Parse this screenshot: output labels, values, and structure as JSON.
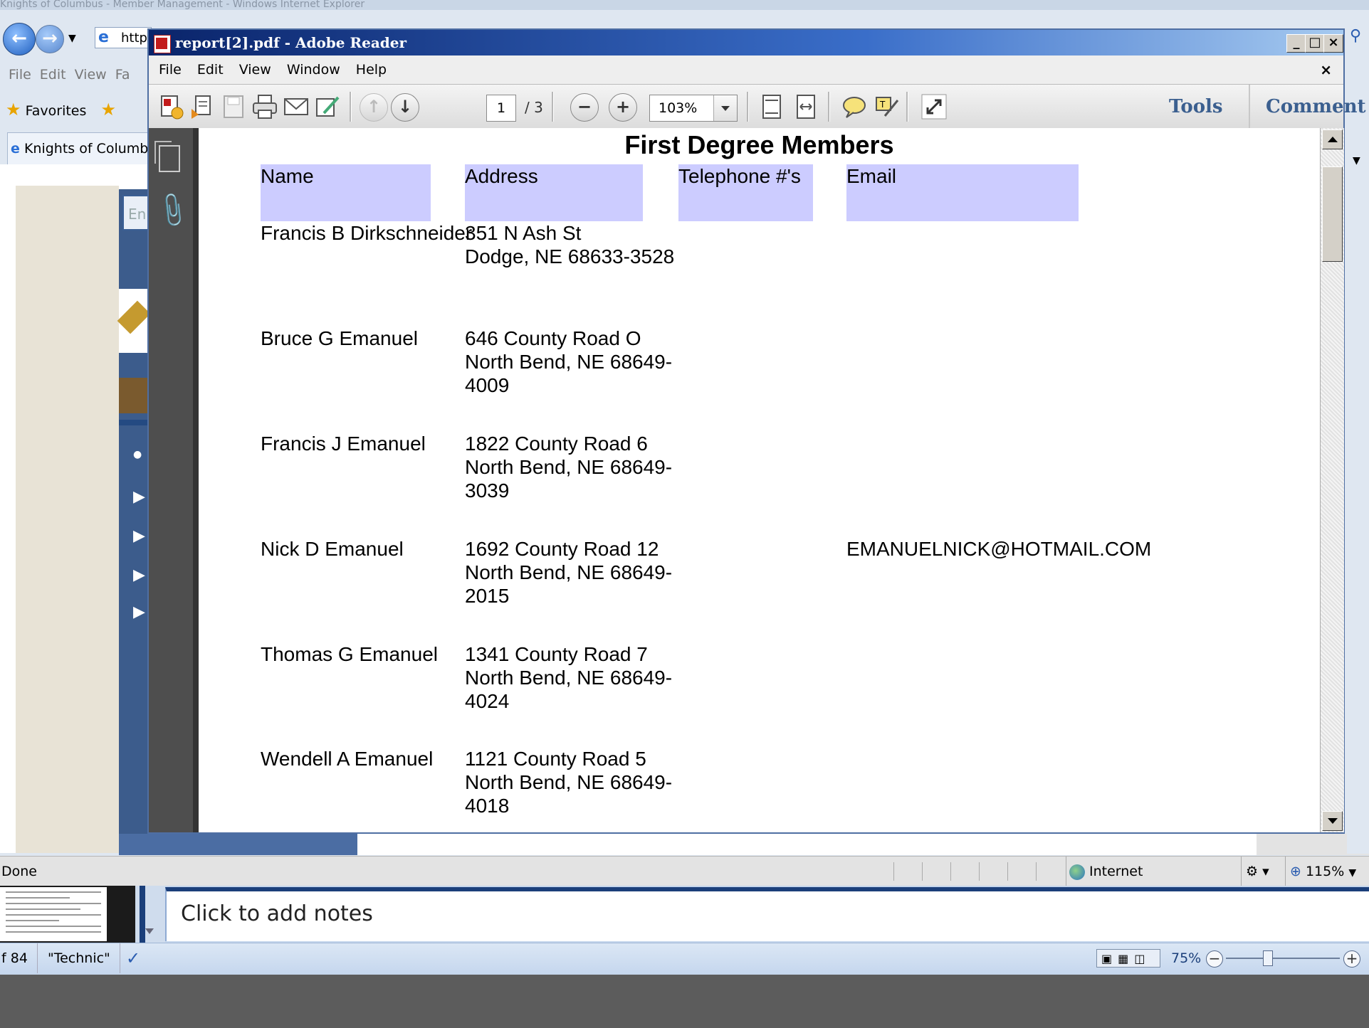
{
  "ie": {
    "title": "Knights of Columbus - Member Management - Windows Internet Explorer",
    "address_prefix": "http:",
    "menu": [
      "File",
      "Edit",
      "View",
      "Fa"
    ],
    "favorites_label": "Favorites",
    "tab_label": "Knights of Columbus",
    "page_input_text": "En",
    "status_text": "Done",
    "zone_text": "Internet",
    "zoom_text": "115%"
  },
  "reader": {
    "title": "report[2].pdf - Adobe Reader",
    "menu": [
      "File",
      "Edit",
      "View",
      "Window",
      "Help"
    ],
    "current_page": "1",
    "total_pages": "/ 3",
    "zoom": "103%",
    "tools_label": "Tools",
    "comment_label": "Comment"
  },
  "document": {
    "title": "First Degree Members",
    "columns": [
      "Name",
      "Address",
      "Telephone #'s",
      "Email"
    ],
    "rows": [
      {
        "name": "Francis B Dirkschneider",
        "address": "351 N Ash St\nDodge, NE 68633-3528",
        "phone": "",
        "email": ""
      },
      {
        "name": "Bruce G Emanuel",
        "address": "646 County Road O\nNorth Bend, NE 68649-\n4009",
        "phone": "",
        "email": ""
      },
      {
        "name": "Francis J Emanuel",
        "address": "1822 County Road 6\nNorth Bend, NE 68649-\n3039",
        "phone": "",
        "email": ""
      },
      {
        "name": "Nick D Emanuel",
        "address": "1692 County Road 12\nNorth Bend, NE 68649-\n2015",
        "phone": "",
        "email": "EMANUELNICK@HOTMAIL.COM"
      },
      {
        "name": "Thomas G Emanuel",
        "address": "1341 County Road 7\nNorth Bend, NE 68649-\n4024",
        "phone": "",
        "email": ""
      },
      {
        "name": "Wendell A Emanuel",
        "address": "1121 County Road 5\nNorth Bend, NE 68649-\n4018",
        "phone": "",
        "email": ""
      }
    ]
  },
  "ppt": {
    "notes_placeholder": "Click to add notes",
    "slide_counter": "f 84",
    "theme": "\"Technic\"",
    "zoom": "75%"
  }
}
